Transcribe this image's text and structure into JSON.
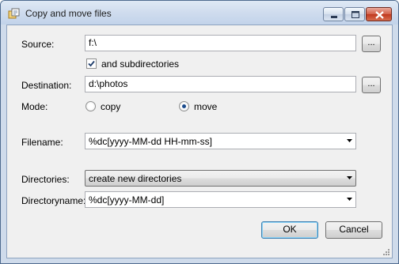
{
  "window": {
    "title": "Copy and move files",
    "icon": "copy-files-icon"
  },
  "form": {
    "source_label": "Source:",
    "source_value": "f:\\",
    "browse_label": "...",
    "subdirs_label": "and subdirectories",
    "subdirs_checked": true,
    "destination_label": "Destination:",
    "destination_value": "d:\\photos",
    "mode_label": "Mode:",
    "mode_options": [
      {
        "label": "copy",
        "selected": false
      },
      {
        "label": "move",
        "selected": true
      }
    ],
    "filename_label": "Filename:",
    "filename_value": "%dc[yyyy-MM-dd HH-mm-ss]",
    "directories_label": "Directories:",
    "directories_value": "create new directories",
    "directoryname_label": "Directoryname:",
    "directoryname_value": "%dc[yyyy-MM-dd]"
  },
  "buttons": {
    "ok": "OK",
    "cancel": "Cancel"
  },
  "colors": {
    "accent": "#3c7fb1",
    "radio_dot": "#1a4a8c",
    "close_red": "#c0381e"
  }
}
